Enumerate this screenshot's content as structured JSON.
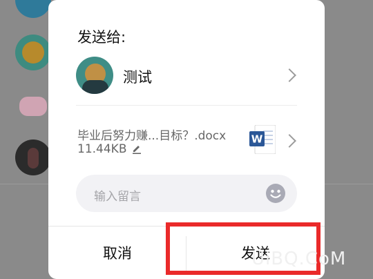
{
  "dialog": {
    "title": "发送给:",
    "recipient": {
      "name": "测试"
    },
    "file": {
      "name": "毕业后努力赚...目标？.docx",
      "size": "11.44KB"
    },
    "message": {
      "placeholder": "输入留言"
    },
    "buttons": {
      "cancel": "取消",
      "send": "发送"
    }
  },
  "watermark": "UiBQ.CoM",
  "colors": {
    "highlight": "#ea2a2a",
    "word_blue": "#2b5797"
  }
}
